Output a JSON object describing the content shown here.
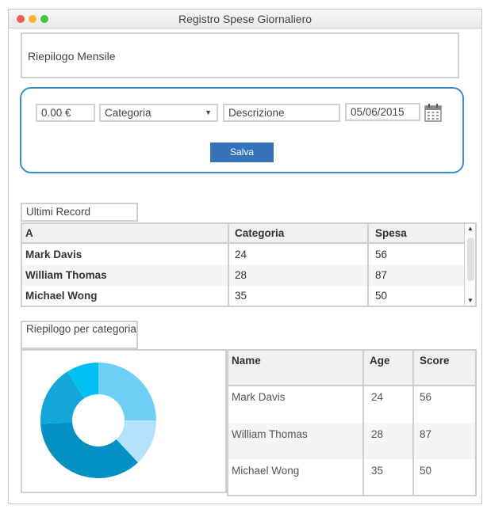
{
  "window": {
    "title": "Registro Spese Giornaliero"
  },
  "summary": {
    "label": "Riepilogo Mensile"
  },
  "form": {
    "amount": "0.00 €",
    "category": "Categoria",
    "description_placeholder": "Descrizione",
    "date": "05/06/2015",
    "save_label": "Salva"
  },
  "recent": {
    "label": "Ultimi Record",
    "columns": [
      "A",
      "Categoria",
      "Spesa"
    ],
    "rows": [
      [
        "Mark Davis",
        "24",
        "56"
      ],
      [
        "William Thomas",
        "28",
        "87"
      ],
      [
        "Michael Wong",
        "35",
        "50"
      ]
    ]
  },
  "by_category": {
    "label": "Riepilogo per categoria"
  },
  "chart_data": {
    "type": "pie",
    "donut": true,
    "values": [
      25,
      13,
      36,
      17,
      9
    ],
    "colors": [
      "#6ecff6",
      "#b3e3f9",
      "#0591c3",
      "#12a7d8",
      "#00c0f3"
    ]
  },
  "people": {
    "columns": [
      "Name",
      "Age",
      "Score"
    ],
    "rows": [
      [
        "Mark Davis",
        "24",
        "56"
      ],
      [
        "William Thomas",
        "28",
        "87"
      ],
      [
        "Michael Wong",
        "35",
        "50"
      ]
    ]
  }
}
